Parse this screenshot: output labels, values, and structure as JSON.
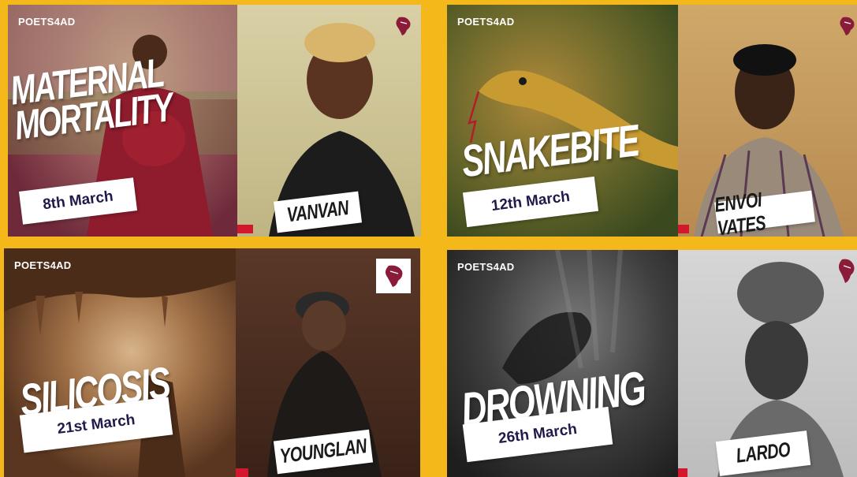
{
  "cards": [
    {
      "brand": "POETS4AD",
      "headline_lines": [
        "MATERNAL",
        "MORTALITY"
      ],
      "date": "8th March",
      "poet": "VANVAN",
      "left_bg": "#8c4a55",
      "right_bg": "#cfc59a"
    },
    {
      "brand": "POETS4AD",
      "headline_lines": [
        "SNAKEBITE"
      ],
      "date": "12th March",
      "poet": "ENVOI VATES",
      "left_bg": "#6a6a2c",
      "right_bg": "#c7a064"
    },
    {
      "brand": "POETS4AD",
      "headline_lines": [
        "SILICOSIS"
      ],
      "date": "21st March",
      "poet": "YOUNGLAN",
      "left_bg": "#7a4e2e",
      "right_bg": "#4a2c20"
    },
    {
      "brand": "POETS4AD",
      "headline_lines": [
        "DROWNING"
      ],
      "date": "26th March",
      "poet": "LARDO",
      "left_bg": "#3a3a3a",
      "right_bg": "#cfcfcf"
    }
  ],
  "icons": {
    "logo": "africa-map-logo",
    "sponsors": "sponsor-logos"
  },
  "colors": {
    "frame": "#f4b81a",
    "date_text": "#1f1a4a"
  }
}
